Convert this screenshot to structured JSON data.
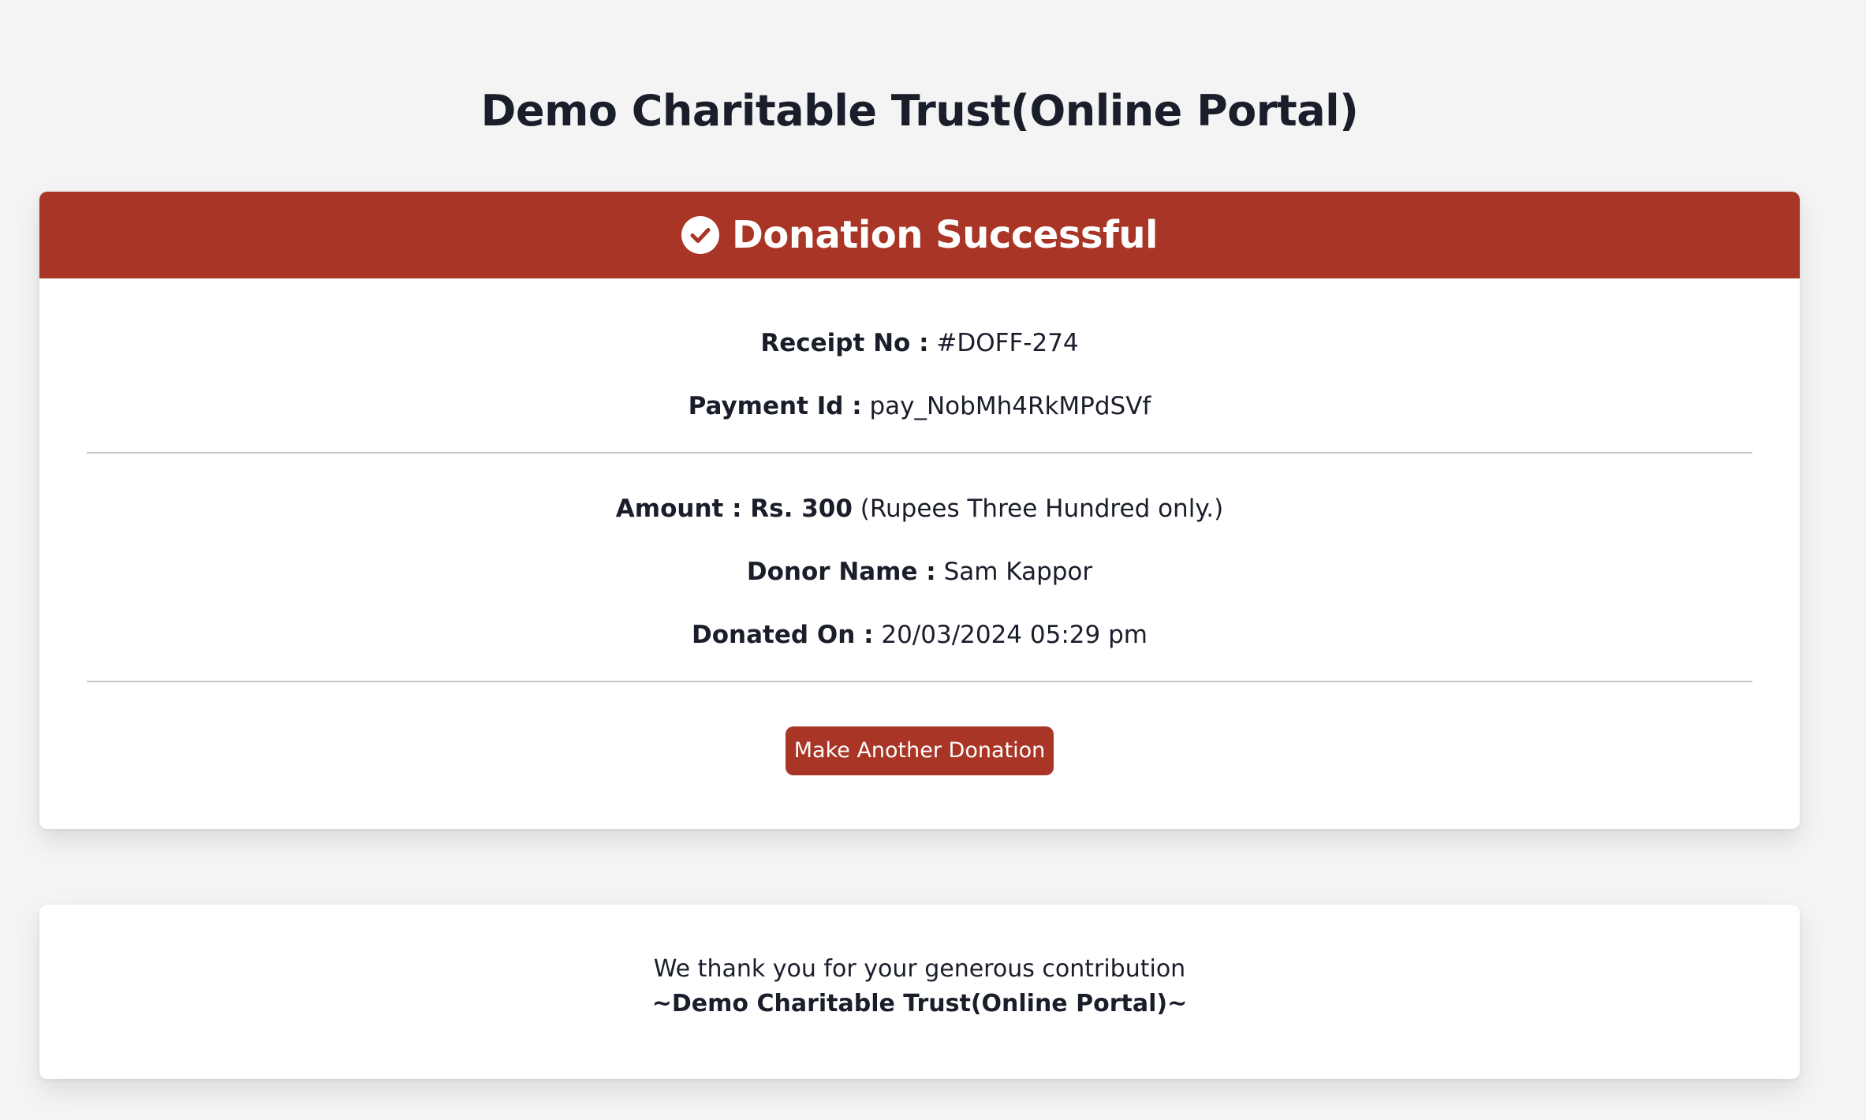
{
  "page": {
    "title": "Demo Charitable Trust(Online Portal)"
  },
  "banner": {
    "icon": "check-circle-icon",
    "title": "Donation Successful",
    "color": "#a83526"
  },
  "receipt": {
    "receipt_no_label": "Receipt No :",
    "receipt_no_value": "#DOFF-274",
    "payment_id_label": "Payment Id :",
    "payment_id_value": "pay_NobMh4RkMPdSVf",
    "amount_label": "Amount : Rs. 300",
    "amount_words": "(Rupees Three Hundred only.)",
    "donor_name_label": "Donor Name :",
    "donor_name_value": "Sam Kappor",
    "donated_on_label": "Donated On :",
    "donated_on_value": "20/03/2024 05:29 pm"
  },
  "actions": {
    "another_donation_label": "Make Another Donation"
  },
  "thanks": {
    "message": "We thank you for your generous contribution",
    "signature": "~Demo Charitable Trust(Online Portal)~"
  },
  "colors": {
    "accent": "#a83526",
    "background": "#f4f4f4",
    "card": "#ffffff",
    "text": "#1a1e2b"
  }
}
